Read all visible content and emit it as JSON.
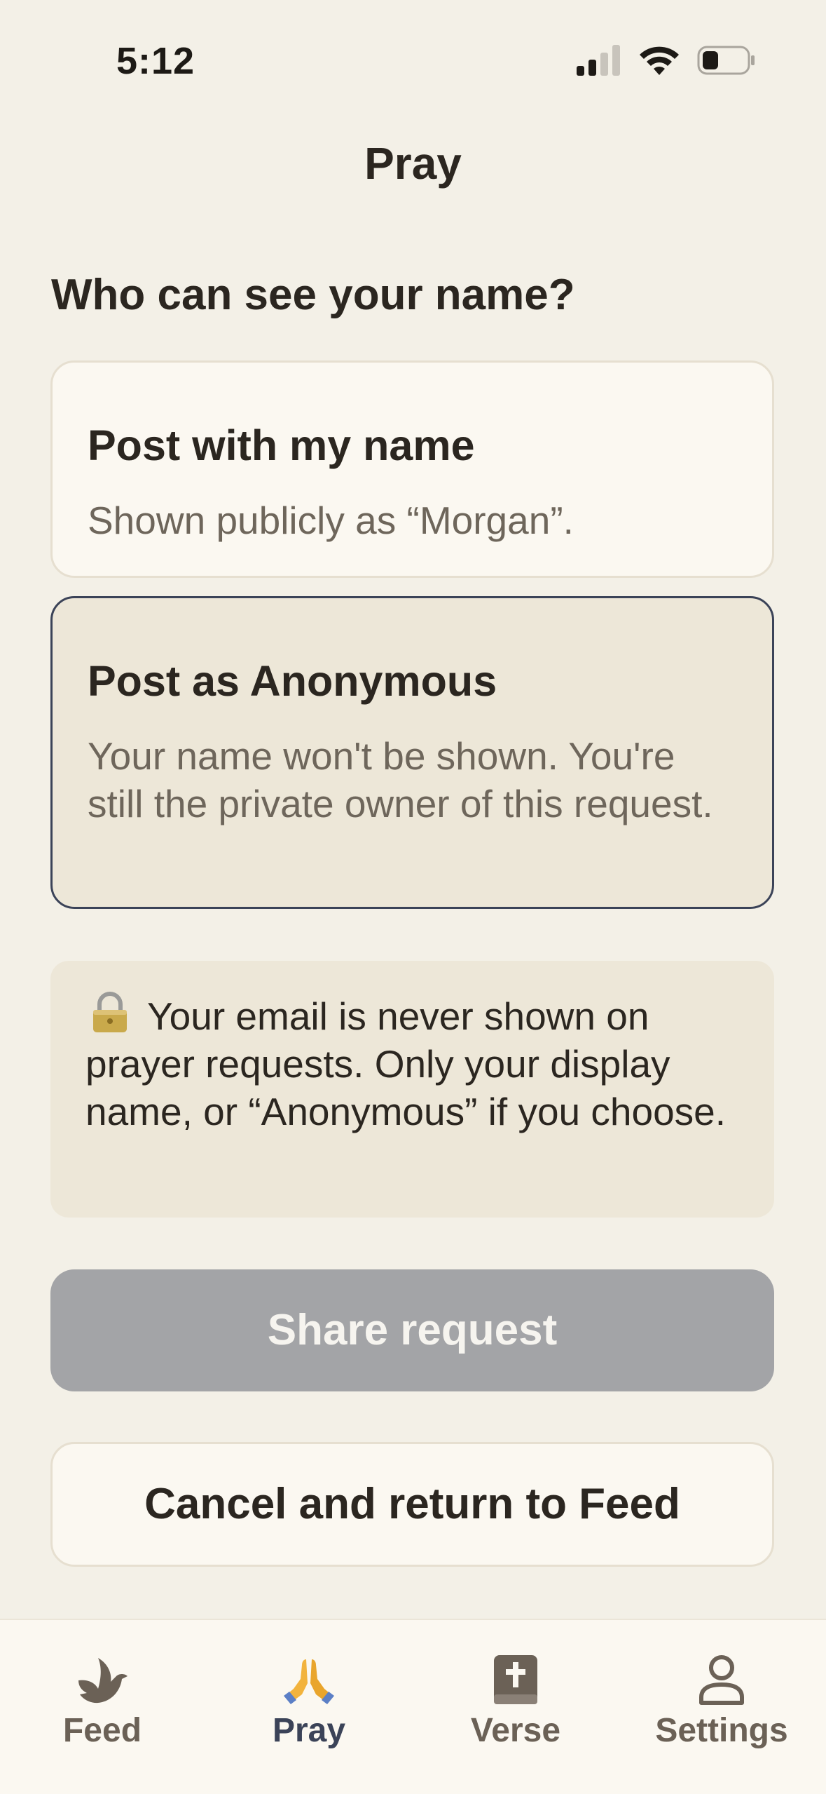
{
  "status_bar": {
    "time": "5:12"
  },
  "nav": {
    "title": "Pray"
  },
  "visibility": {
    "heading": "Who can see your name?",
    "options": [
      {
        "title": "Post with my name",
        "description": "Shown publicly as “Morgan”.",
        "selected": false
      },
      {
        "title": "Post as Anonymous",
        "description": "Your name won't be shown. You're still the private owner of this request.",
        "selected": true
      }
    ]
  },
  "privacy_note": {
    "icon": "lock-icon",
    "text": "Your email is never shown on prayer requests. Only your display name, or “Anonymous” if you choose."
  },
  "actions": {
    "share_label": "Share request",
    "share_enabled": false,
    "cancel_label": "Cancel and return to Feed"
  },
  "tab_bar": {
    "active": "Pray",
    "items": [
      {
        "label": "Feed",
        "icon": "dove-icon"
      },
      {
        "label": "Pray",
        "icon": "praying-hands-icon"
      },
      {
        "label": "Verse",
        "icon": "bible-icon"
      },
      {
        "label": "Settings",
        "icon": "person-icon"
      }
    ]
  },
  "colors": {
    "background": "#f3f0e7",
    "card": "#fbf8f1",
    "selected_card": "#ede7d8",
    "selected_border": "#3b4358",
    "disabled_button": "#a3a4a7",
    "active_tab": "#3b4358"
  }
}
